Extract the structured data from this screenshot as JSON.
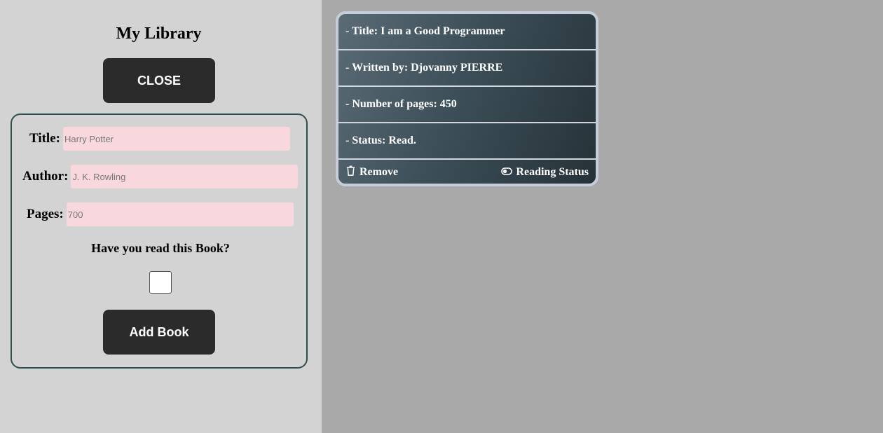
{
  "app": {
    "title": "My Library",
    "close_label": "CLOSE"
  },
  "form": {
    "title_label": "Title:",
    "title_placeholder": "Harry Potter",
    "author_label": "Author:",
    "author_placeholder": "J. K. Rowling",
    "pages_label": "Pages:",
    "pages_placeholder": "700",
    "read_question": "Have you read this Book?",
    "read_checked": false,
    "add_label": "Add Book"
  },
  "book": {
    "title_line": "- Title: I am a Good Programmer",
    "author_line": "- Written by: Djovanny PIERRE",
    "pages_line": "- Number of pages: 450",
    "status_line": "- Status: Read.",
    "remove_label": "Remove",
    "status_toggle_label": "Reading Status",
    "remove_icon": "trash-icon",
    "status_icon": "toggle-icon"
  },
  "colors": {
    "sidebar_bg": "#d3d3d3",
    "page_bg": "#a9a9a9",
    "button_bg": "#2b2b2b",
    "input_bg": "#f8d8dc",
    "form_border": "#2f4f4f"
  }
}
